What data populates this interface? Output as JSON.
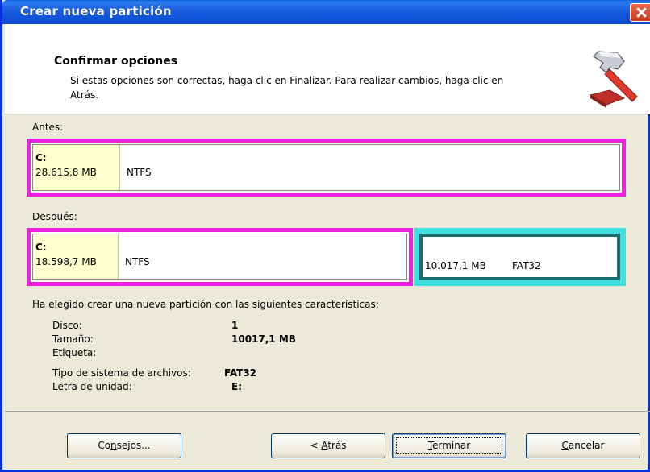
{
  "window": {
    "title": "Crear nueva partición"
  },
  "header": {
    "title": "Confirmar opciones",
    "description": "Si estas opciones son correctas, haga clic en Finalizar. Para realizar cambios, haga clic en Atrás."
  },
  "before": {
    "label": "Antes:",
    "partition": {
      "letter": "C:",
      "size": "28.615,8 MB",
      "fs": "NTFS"
    }
  },
  "after": {
    "label": "Después:",
    "partition": {
      "letter": "C:",
      "size": "18.598,7 MB",
      "fs": "NTFS"
    },
    "new_partition": {
      "size": "10.017,1 MB",
      "fs": "FAT32"
    }
  },
  "summary": {
    "intro": "Ha elegido crear una nueva partición con las siguientes características:",
    "rows": [
      {
        "key": "Disco:",
        "value": "1"
      },
      {
        "key": "Tamaño:",
        "value": "10017,1 MB"
      },
      {
        "key": "Etiqueta:",
        "value": ""
      },
      {
        "key": "Tipo de sistema de archivos:",
        "value": "FAT32"
      },
      {
        "key": "Letra de unidad:",
        "value": "E:"
      }
    ]
  },
  "buttons": {
    "tips": {
      "pre": "Co",
      "mnemonic": "n",
      "post": "sejos..."
    },
    "back": {
      "pre": "< ",
      "mnemonic": "A",
      "post": "trás"
    },
    "finish": {
      "pre": "",
      "mnemonic": "T",
      "post": "erminar"
    },
    "cancel": {
      "pre": "",
      "mnemonic": "C",
      "post": "ancelar"
    }
  },
  "colors": {
    "titlebar": "#0f4fd6",
    "primary_partition_border": "#f020e0",
    "new_partition_border": "#40e0e0",
    "drive_cell_bg": "#ffffd0"
  },
  "icons": {
    "header": "hammer-icon",
    "close": "close-icon"
  }
}
